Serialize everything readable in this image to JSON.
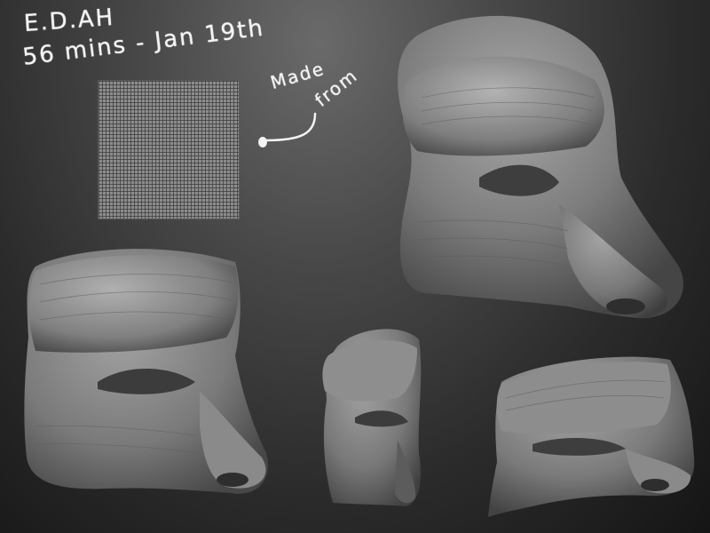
{
  "annotations": {
    "title_line1": "E.D.AH",
    "title_line2": "56 mins - Jan 19th",
    "note_line1": "Made",
    "note_line2": "from"
  },
  "palette": {
    "background_center": "#6a6a6a",
    "background_edge": "#151515",
    "clay_light": "#9a9a9a",
    "clay_mid": "#7a7a7a",
    "clay_dark": "#4a4a4a",
    "handwriting": "#f4f4f4"
  }
}
